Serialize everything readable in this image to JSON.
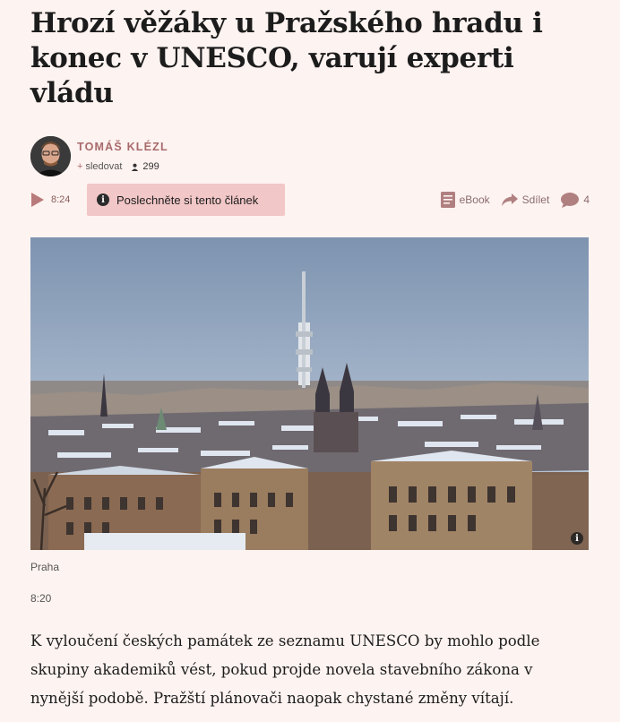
{
  "article": {
    "headline": "Hrozí věžáky u Pražského hradu i konec v UNESCO, varují experti vládu",
    "lead": "K vyloučení českých památek ze seznamu UNESCO by mohlo podle skupiny akademiků vést, pokud projde novela stavebního zákona v nynější podobě. Pražští plánovači naopak chystané změny vítají.",
    "photo_caption": "Praha",
    "published_time": "8:20"
  },
  "author": {
    "name": "TOMÁŠ KLÉZL",
    "follow_label": "sledovat",
    "followers_count": "299"
  },
  "toolbar": {
    "audio_duration": "8:24",
    "listen_label": "Poslechněte si tento článek",
    "ebook_label": "eBook",
    "share_label": "Sdílet",
    "comments_count": "4"
  },
  "icons": {
    "play": "play-icon",
    "info": "info-icon",
    "ebook": "ebook-icon",
    "share": "share-icon",
    "comments": "comment-icon",
    "followers": "person-icon"
  },
  "colors": {
    "background": "#fdf3f1",
    "accent": "#a86a6a",
    "listen_box": "#f2c7c7"
  }
}
